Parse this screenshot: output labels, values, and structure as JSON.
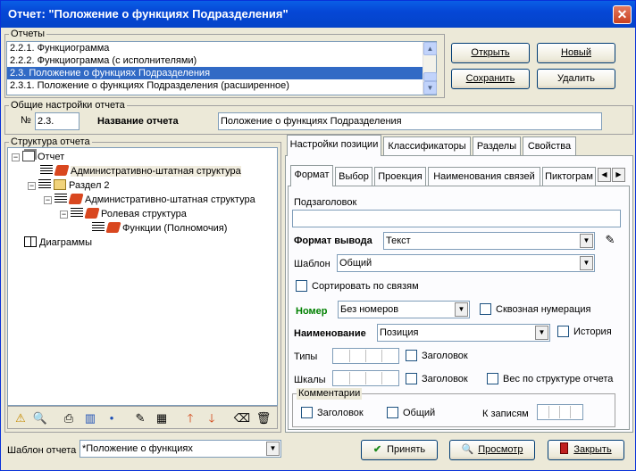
{
  "window": {
    "title": "Отчет: \"Положение о функциях Подразделения\""
  },
  "reports_group": {
    "legend": "Отчеты",
    "items": [
      "2.2.1. Функциограмма",
      "2.2.2. Функциограмма (с исполнителями)",
      "2.3. Положение о функциях Подразделения",
      "2.3.1. Положение о функциях Подразделения (расширенное)"
    ],
    "selected_index": 2
  },
  "buttons": {
    "open": "Открыть",
    "new": "Новый",
    "save": "Сохранить",
    "delete": "Удалить"
  },
  "general": {
    "legend": "Общие настройки отчета",
    "num_label": "№",
    "num_value": "2.3.",
    "name_label": "Название отчета",
    "name_value": "Положение о функциях Подразделения"
  },
  "structure": {
    "legend": "Структура отчета",
    "nodes": [
      {
        "label": "Отчет",
        "icon": "report-icon"
      },
      {
        "label": "Административно-штатная структура",
        "icon": "book-icon"
      },
      {
        "label": "Раздел 2",
        "icon": "folder-icon"
      },
      {
        "label": "Административно-штатная структура",
        "icon": "book-icon"
      },
      {
        "label": "Ролевая структура",
        "icon": "book-icon"
      },
      {
        "label": "Функции (Полномочия)",
        "icon": "book-icon"
      },
      {
        "label": "Диаграммы",
        "icon": "diagram-icon"
      }
    ]
  },
  "tabs_main": [
    "Настройки позиции",
    "Классификаторы",
    "Разделы",
    "Свойства"
  ],
  "tabs_sub": [
    "Формат",
    "Выбор",
    "Проекция",
    "Наименования связей",
    "Пиктограм"
  ],
  "format": {
    "subheading_label": "Подзаголовок",
    "subheading_value": "",
    "output_format_label": "Формат вывода",
    "output_format_value": "Текст",
    "template_label": "Шаблон",
    "template_value": "Общий",
    "sort_label": "Сортировать по связям",
    "number_label": "Номер",
    "number_value": "Без номеров",
    "through_numbering_label": "Сквозная нумерация",
    "name_label": "Наименование",
    "name_value": "Позиция",
    "history_label": "История",
    "types_label": "Типы",
    "types_header_label": "Заголовок",
    "scales_label": "Шкалы",
    "scales_header_label": "Заголовок",
    "weight_label": "Вес по структуре отчета",
    "comments_legend": "Комментарии",
    "comments_header_label": "Заголовок",
    "comments_general_label": "Общий",
    "to_records_label": "К записям"
  },
  "bottom": {
    "template_label": "Шаблон отчета",
    "template_value": "*Положение о функциях",
    "accept": "Принять",
    "preview": "Просмотр",
    "close": "Закрыть"
  },
  "colors": {
    "title_bar": "#0547d6",
    "selection": "#316ac5",
    "close_button": "#c9401f"
  }
}
